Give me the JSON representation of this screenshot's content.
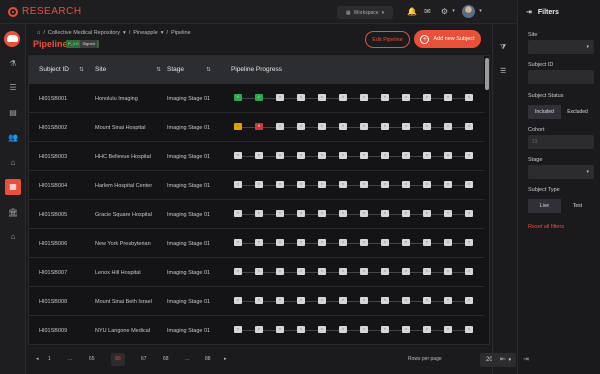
{
  "brand": {
    "name": "RESEARCH"
  },
  "topbar": {
    "workspace": "Workspace"
  },
  "breadcrumb": [
    "Collective Medical Repository",
    "Pineapple",
    "Pipeline"
  ],
  "page": {
    "title": "Pipeline",
    "badge_version": "P_1.0",
    "badge_status": "Signed",
    "edit_label": "Edit Pipeline",
    "add_label": "Add new Subject"
  },
  "table": {
    "headers": [
      "Subject ID",
      "Site",
      "Stage",
      "Pipeline Progress"
    ],
    "rows": [
      {
        "id": "HI01SB001",
        "site": "Honolulu Imaging",
        "stage": "Imaging Stage 01",
        "status": [
          "ok",
          "ok",
          "",
          "",
          "",
          "",
          "",
          "",
          "",
          "",
          "",
          ""
        ]
      },
      {
        "id": "HI01SB002",
        "site": "Mount Sinai Hospital",
        "stage": "Imaging Stage 01",
        "status": [
          "warn",
          "err",
          "",
          "",
          "",
          "",
          "",
          "",
          "",
          "",
          "",
          ""
        ]
      },
      {
        "id": "HI01SB003",
        "site": "HHC Bellevue Hospital",
        "stage": "Imaging Stage 01",
        "status": [
          "",
          "",
          "",
          "",
          "",
          "",
          "",
          "",
          "",
          "",
          "",
          ""
        ]
      },
      {
        "id": "HI01SB004",
        "site": "Harlem Hospital Center",
        "stage": "Imaging Stage 01",
        "status": [
          "",
          "",
          "",
          "",
          "",
          "",
          "",
          "",
          "",
          "",
          "",
          ""
        ]
      },
      {
        "id": "HI01SB005",
        "site": "Gracie Square Hospital",
        "stage": "Imaging Stage 01",
        "status": [
          "",
          "",
          "",
          "",
          "",
          "",
          "",
          "",
          "",
          "",
          "",
          ""
        ]
      },
      {
        "id": "HI01SB006",
        "site": "New York Presbyterian",
        "stage": "Imaging Stage 01",
        "status": [
          "",
          "",
          "",
          "",
          "",
          "",
          "",
          "",
          "",
          "",
          "",
          ""
        ]
      },
      {
        "id": "HI01SB007",
        "site": "Lenox Hill Hospital",
        "stage": "Imaging Stage 01",
        "status": [
          "",
          "",
          "",
          "",
          "",
          "",
          "",
          "",
          "",
          "",
          "",
          ""
        ]
      },
      {
        "id": "HI01SB008",
        "site": "Mount Sinai Beth Israel",
        "stage": "Imaging Stage 01",
        "status": [
          "",
          "",
          "",
          "",
          "",
          "",
          "",
          "",
          "",
          "",
          "",
          ""
        ]
      },
      {
        "id": "HI01SB009",
        "site": "NYU Langone Medical",
        "stage": "Imaging Stage 01",
        "status": [
          "",
          "",
          "",
          "",
          "",
          "",
          "",
          "",
          "",
          "",
          "",
          ""
        ]
      },
      {
        "id": "HI01SB010",
        "site": "Weill Cornell Medical",
        "stage": "Imaging Stage 01",
        "status": [
          "",
          "",
          "",
          "",
          "",
          "",
          "",
          "",
          "",
          "",
          "",
          ""
        ]
      }
    ]
  },
  "pagination": {
    "pages": [
      "1",
      "...",
      "65",
      "66",
      "67",
      "68",
      "...",
      "88"
    ],
    "current": "66",
    "rows_label": "Rows per page",
    "rows_value": "20"
  },
  "filters": {
    "title": "Filters",
    "site_label": "Site",
    "subject_id_label": "Subject ID",
    "subject_status_label": "Subject Status",
    "status_options": [
      "Included",
      "Excluded"
    ],
    "cohort_label": "Cohort",
    "cohort_placeholder": "13",
    "stage_label": "Stage",
    "subject_type_label": "Subject Type",
    "type_options": [
      "Live",
      "Test"
    ],
    "reset": "Reset all filters"
  },
  "colors": {
    "accent": "#e8503a",
    "ok": "#2ea84a",
    "warn": "#e5a100",
    "err": "#c93a3a"
  }
}
